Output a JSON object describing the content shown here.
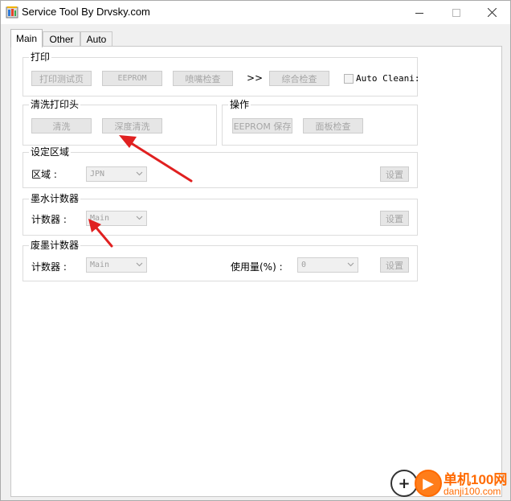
{
  "window": {
    "title": "Service Tool By Drvsky.com"
  },
  "tabs": [
    {
      "label": "Main"
    },
    {
      "label": "Other"
    },
    {
      "label": "Auto"
    }
  ],
  "print_group": {
    "title": "打印",
    "btn_test_page": "打印测试页",
    "btn_eeprom": "EEPROM",
    "btn_nozzle": "喷嘴检查",
    "sep": ">>",
    "btn_combined": "综合检查",
    "auto_clean_label": "Auto Cleani:"
  },
  "clean_group": {
    "title": "清洗打印头",
    "btn_clean": "清洗",
    "btn_deep_clean": "深度清洗"
  },
  "op_group": {
    "title": "操作",
    "btn_eeprom_save": "EEPROM 保存",
    "btn_panel_check": "面板检查"
  },
  "region_group": {
    "title": "设定区域",
    "label": "区域 :",
    "value": "JPN",
    "btn_set": "设置"
  },
  "ink_group": {
    "title": "墨水计数器",
    "label": "计数器 :",
    "value": "Main",
    "btn_set": "设置"
  },
  "waste_group": {
    "title": "废墨计数器",
    "label": "计数器 :",
    "value": "Main",
    "usage_label": "使用量(%) :",
    "usage_value": "0",
    "btn_set": "设置"
  },
  "watermark": {
    "text1": "单机100网",
    "text2": "danji100.com",
    "accent": "#ff6a00"
  },
  "colors": {
    "annotation_arrow": "#e02020"
  }
}
